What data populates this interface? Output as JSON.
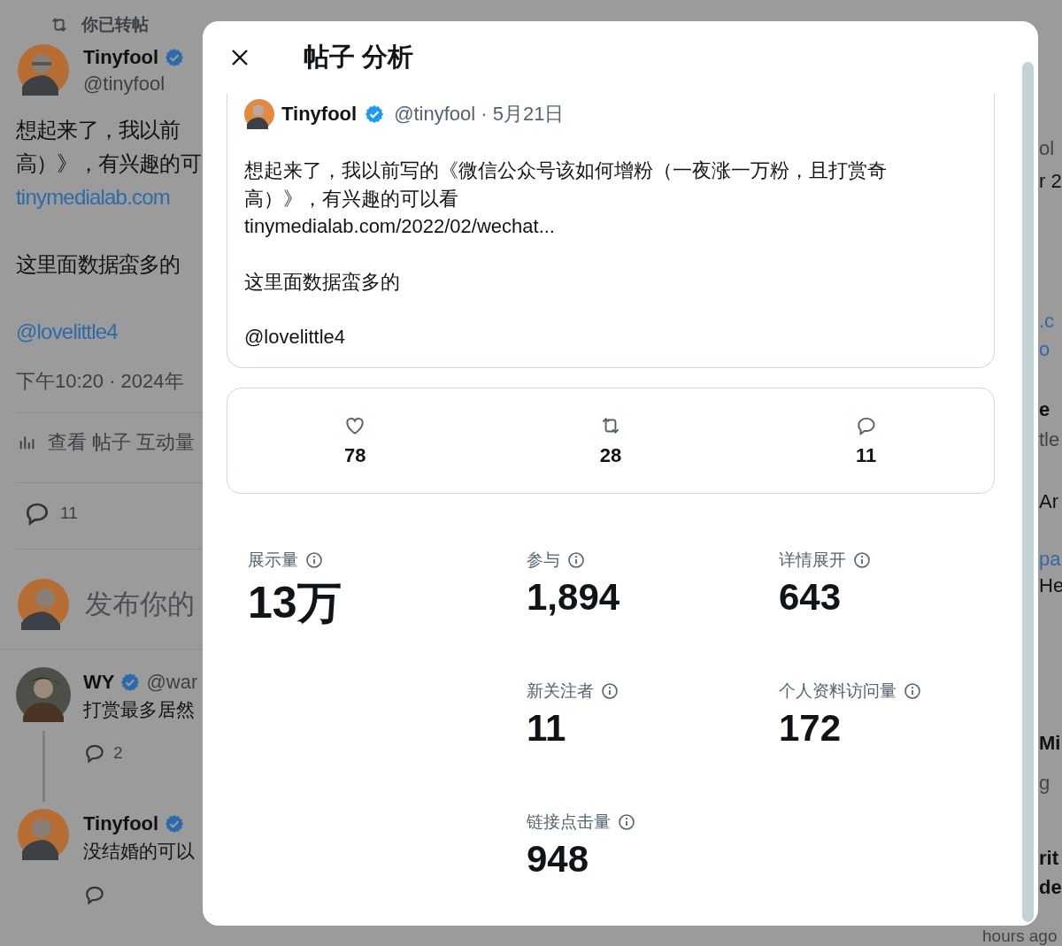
{
  "background": {
    "repost_note": "你已转帖",
    "post": {
      "name": "Tinyfool",
      "handle": "@tinyfool",
      "lines": [
        "想起来了，我以前",
        "高）》，有兴趣的可"
      ],
      "link": "tinymedialab.com",
      "text2": "这里面数据蛮多的",
      "mention": "@lovelittle4",
      "time": "下午10:20 · 2024年",
      "engagements": "查看 帖子 互动量",
      "reply_count": "11"
    },
    "compose": {
      "placeholder": "发布你的"
    },
    "replies": [
      {
        "name": "WY",
        "handle": "@war",
        "text": "打赏最多居然",
        "reply_count": "2"
      },
      {
        "name": "Tinyfool",
        "text": "没结婚的可以"
      }
    ],
    "side_fragments": [
      {
        "text": "ol",
        "kind": "muted"
      },
      {
        "text": "r 2",
        "kind": "plain"
      },
      {
        "text": ".c",
        "kind": "link"
      },
      {
        "text": "o",
        "kind": "link"
      },
      {
        "text": "e",
        "kind": "bold"
      },
      {
        "text": "tle",
        "kind": "muted"
      },
      {
        "text": "Ar",
        "kind": "plain"
      },
      {
        "text": "pa",
        "kind": "link"
      },
      {
        "text": "He",
        "kind": "plain"
      },
      {
        "text": "Mi",
        "kind": "bold"
      },
      {
        "text": "g",
        "kind": "muted"
      },
      {
        "text": "rit",
        "kind": "bold"
      },
      {
        "text": "de",
        "kind": "bold"
      }
    ],
    "bottom_note": "hours ago"
  },
  "modal": {
    "title": "帖子 分析",
    "post": {
      "name": "Tinyfool",
      "handle": "@tinyfool · 5月21日",
      "paragraphs": [
        [
          "想起来了，我以前写的《微信公众号该如何增粉（一夜涨一万粉，且打赏奇",
          "高）》，有兴趣的可以看",
          "tinymedialab.com/2022/02/wechat..."
        ],
        [
          "这里面数据蛮多的"
        ],
        [
          "@lovelittle4"
        ]
      ]
    },
    "counts": [
      {
        "kind": "like",
        "value": "78"
      },
      {
        "kind": "repost",
        "value": "28"
      },
      {
        "kind": "reply",
        "value": "11"
      }
    ],
    "metrics": [
      {
        "label": "展示量",
        "value": "13万"
      },
      {
        "label": "参与",
        "value": "1,894"
      },
      {
        "label": "详情展开",
        "value": "643"
      },
      {
        "label": "新关注者",
        "value": "11"
      },
      {
        "label": "个人资料访问量",
        "value": "172"
      },
      {
        "label": "链接点击量",
        "value": "948"
      }
    ]
  }
}
